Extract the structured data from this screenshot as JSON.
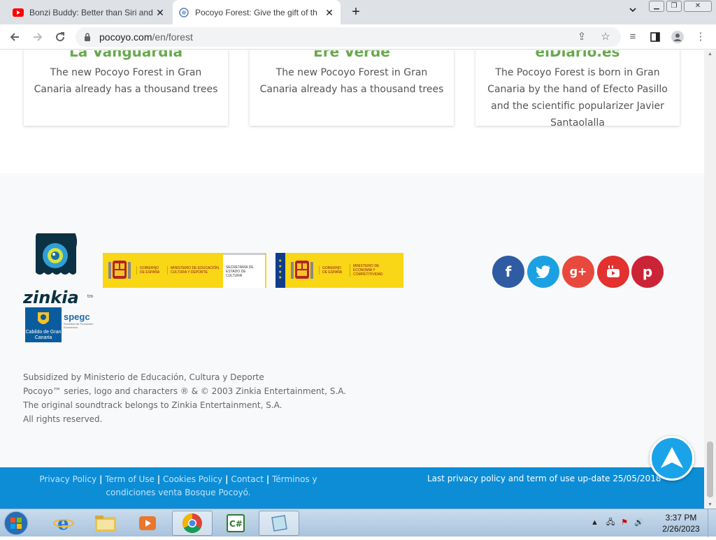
{
  "browser": {
    "tabs": [
      {
        "title": "Bonzi Buddy: Better than Siri and",
        "favicon": "youtube-icon",
        "active": false
      },
      {
        "title": "Pocoyo Forest: Give the gift of th",
        "favicon": "pocoyo-icon",
        "active": true
      }
    ],
    "new_tab": "+",
    "url_host": "pocoyo.com",
    "url_path": "/en/forest"
  },
  "cards": [
    {
      "source": "La Vanguardia",
      "text": "The new Pocoyo Forest in Gran Canaria already has a thousand trees"
    },
    {
      "source": "Ere Verde",
      "text": "The new Pocoyo Forest in Gran Canaria already has a thousand trees"
    },
    {
      "source": "elDiario.es",
      "text": "The Pocoyo Forest is born in Gran Canaria by the hand of Efecto Pasillo and the scientific popularizer Javier Santaolalla"
    }
  ],
  "logos": {
    "zinkia": "zinkia",
    "zinkia_tm": "tm",
    "cabildo": "Cabildo de Gran Canaria",
    "spegc": "spegc",
    "spegc_sub": "Sociedad de Promoción Económica",
    "gov1_a": "GOBIERNO DE ESPAÑA",
    "gov1_b": "MINISTERIO DE EDUCACIÓN, CULTURA Y DEPORTE",
    "gov1_c": "SECRETARÍA DE ESTADO DE CULTURA",
    "gov2_a": "GOBIERNO DE ESPAÑA",
    "gov2_b": "MINISTERIO DE ECONOMÍA Y COMPETITIVIDAD"
  },
  "social": [
    {
      "name": "facebook",
      "glyph": "f",
      "color": "#2f5ba3"
    },
    {
      "name": "twitter",
      "glyph": "t",
      "color": "#1ba1e2"
    },
    {
      "name": "google-plus",
      "glyph": "g+",
      "color": "#e8493e"
    },
    {
      "name": "youtube",
      "glyph": "▶",
      "color": "#e2312f"
    },
    {
      "name": "pinterest",
      "glyph": "p",
      "color": "#cb2436"
    }
  ],
  "legal": [
    "Subsidized by Ministerio de Educación, Cultura y Deporte",
    "Pocoyo™ series, logo and characters ® & © 2003 Zinkia Entertainment, S.A.",
    "The original soundtrack belongs to Zinkia Entertainment, S.A.",
    "All rights reserved."
  ],
  "footer": {
    "links": [
      "Privacy Policy",
      "Term of Use",
      "Cookies Policy",
      "Contact",
      "Términos y condiciones venta Bosque Pocoyó."
    ],
    "separator": "|",
    "update_text": "Last privacy policy and term of use up-date 25/05/2018"
  },
  "taskbar": {
    "time": "3:37 PM",
    "date": "2/26/2023"
  },
  "colors": {
    "card_title": "#6aa84f",
    "footer_blue": "#0c8dd6",
    "gov_yellow": "#f9d616"
  }
}
